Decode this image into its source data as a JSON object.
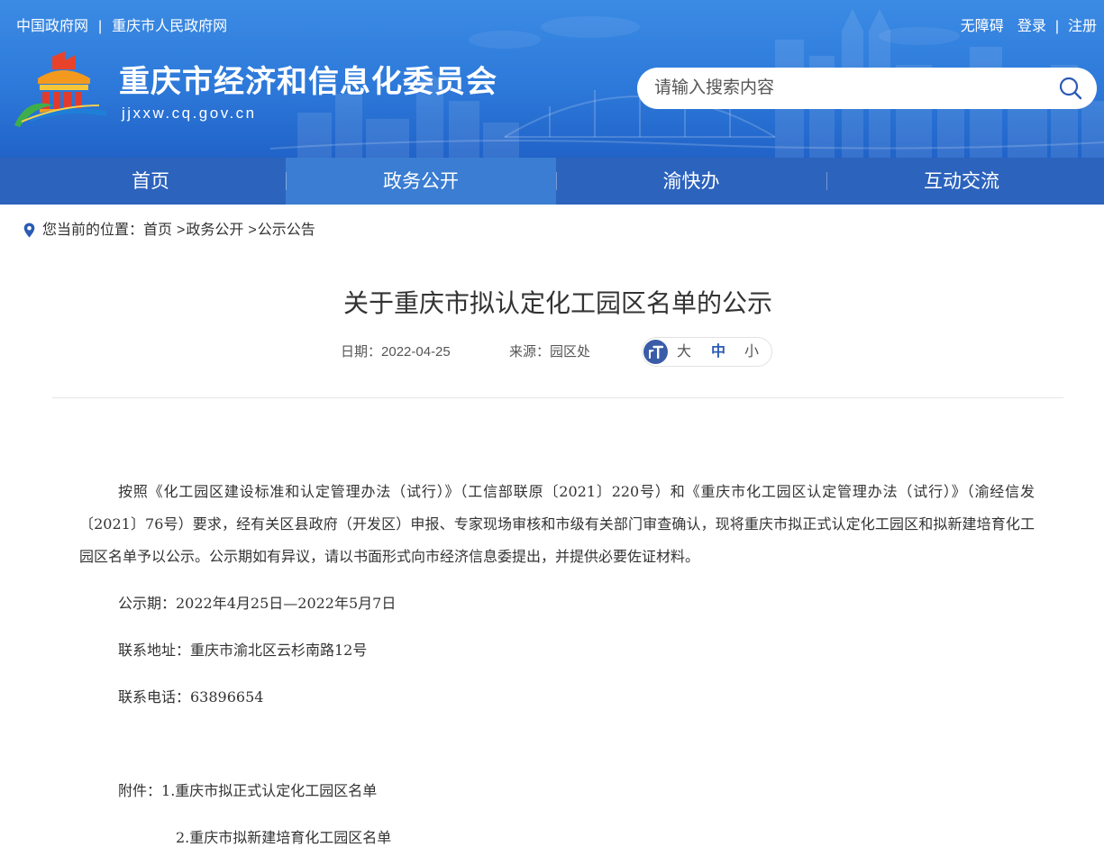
{
  "header": {
    "top_links_left": [
      "中国政府网",
      "重庆市人民政府网"
    ],
    "divider": "|",
    "top_links_right": {
      "accessibility": "无障碍",
      "login": "登录",
      "register": "注册"
    },
    "site_title": "重庆市经济和信息化委员会",
    "site_domain": "jjxxw.cq.gov.cn",
    "search": {
      "placeholder": "请输入搜索内容"
    }
  },
  "nav": {
    "items": [
      {
        "label": "首页",
        "active": false
      },
      {
        "label": "政务公开",
        "active": true
      },
      {
        "label": "渝快办",
        "active": false
      },
      {
        "label": "互动交流",
        "active": false
      }
    ]
  },
  "breadcrumb": {
    "label": "您当前的位置：",
    "items": [
      "首页",
      "政务公开",
      "公示公告"
    ],
    "separator": ">"
  },
  "article": {
    "title": "关于重庆市拟认定化工园区名单的公示",
    "date_label": "日期：",
    "date": "2022-04-25",
    "source_label": "来源：",
    "source": "园区处",
    "font_size_control": {
      "options": [
        {
          "label": "大",
          "active": false
        },
        {
          "label": "中",
          "active": true
        },
        {
          "label": "小",
          "active": false
        }
      ]
    },
    "body": [
      "按照《化工园区建设标准和认定管理办法（试行）》（工信部联原〔2021〕220号）和《重庆市化工园区认定管理办法（试行）》（渝经信发〔2021〕76号）要求，经有关区县政府（开发区）申报、专家现场审核和市级有关部门审查确认，现将重庆市拟正式认定化工园区和拟新建培育化工园区名单予以公示。公示期如有异议，请以书面形式向市经济信息委提出，并提供必要佐证材料。",
      "公示期：2022年4月25日—2022年5月7日",
      "联系地址：重庆市渝北区云杉南路12号",
      "联系电话：63896654"
    ],
    "attachments_label": "附件：",
    "attachments": [
      "1.重庆市拟正式认定化工园区名单",
      "2.重庆市拟新建培育化工园区名单"
    ]
  },
  "icons": {
    "logo": "government-emblem-logo",
    "search": "search-icon",
    "breadcrumb": "location-pin-icon",
    "font_size": "text-size-icon"
  },
  "colors": {
    "header_top": "#3b8be4",
    "header_bottom": "#2163c8",
    "nav_bg": "#2c63bd",
    "nav_active_bg": "#3b7dd2",
    "accent": "#2a5bb5",
    "icon_dark": "#3a5ca8",
    "text": "#333333",
    "muted_text": "#555555"
  }
}
